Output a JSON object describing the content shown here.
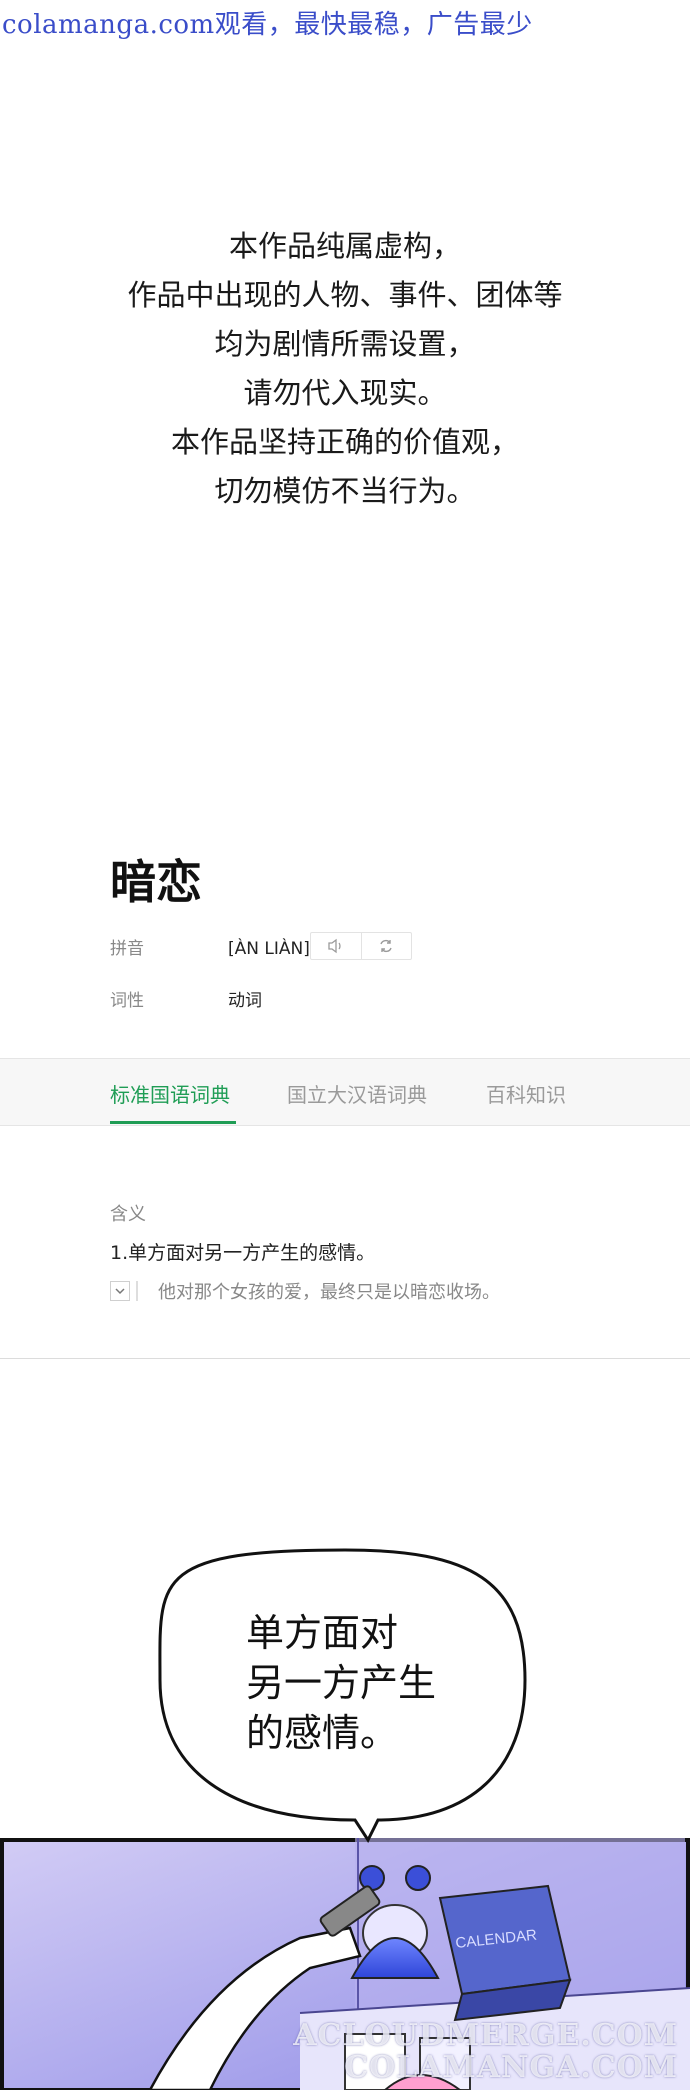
{
  "watermark_top": "colamanga.com观看，最快最稳，广告最少",
  "disclaimer": {
    "lines": [
      "本作品纯属虚构，",
      "作品中出现的人物、事件、团体等",
      "均为剧情所需设置，",
      "请勿代入现实。",
      "本作品坚持正确的价值观，",
      "切勿模仿不当行为。"
    ]
  },
  "dictionary": {
    "word": "暗恋",
    "pinyin_label": "拼音",
    "pinyin": "[ÀN LIÀN]",
    "pos_label": "词性",
    "pos": "动词",
    "tabs": [
      "标准国语词典",
      "国立大汉语词典",
      "百科知识"
    ],
    "meaning_label": "含义",
    "definition": "1.单方面对另一方产生的感情。",
    "example": "他对那个女孩的爱，最终只是以暗恋收场。"
  },
  "comic": {
    "bubble_lines": [
      "单方面对",
      "另一方产生",
      "的感情。"
    ],
    "calendar_label": "CALENDAR"
  },
  "watermark_bottom": [
    "ACLOUDMERGE.COM",
    "COLAMANGA.COM"
  ]
}
